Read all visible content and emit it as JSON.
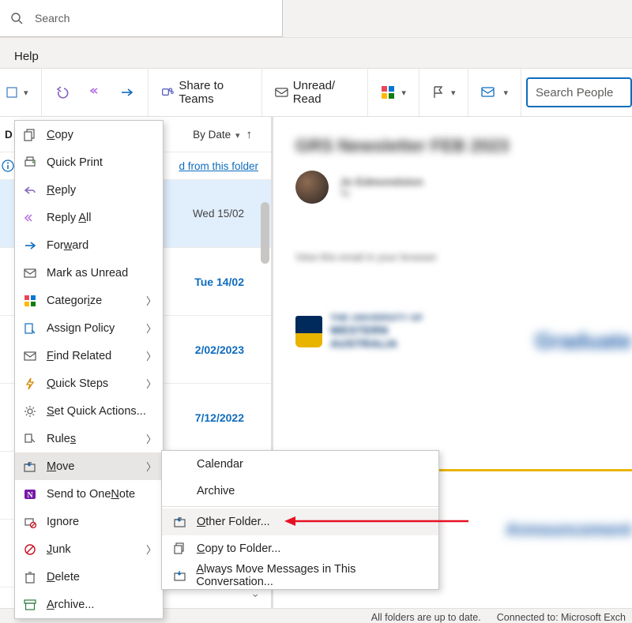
{
  "search": {
    "placeholder": "Search"
  },
  "tabs": {
    "help": "Help"
  },
  "ribbon": {
    "share_teams": "Share to Teams",
    "unread_read": "Unread/ Read",
    "search_people_placeholder": "Search People"
  },
  "list": {
    "sort_label": "By Date",
    "focused_link": "d from this folder",
    "dates": [
      "Wed 15/02",
      "Tue 14/02",
      "2/02/2023",
      "7/12/2022"
    ]
  },
  "reading": {
    "subject": "GRS Newsletter FEB 2023",
    "sender_name": "Jo Edmondston",
    "sender_to": "To",
    "view_hint": "View this email in your browser",
    "uwa_line1": "THE UNIVERSITY OF",
    "uwa_line2": "WESTERN",
    "uwa_line3": "AUSTRALIA",
    "graduate": "Graduate",
    "announce": "Announcement"
  },
  "context_menu": {
    "copy": "Copy",
    "quick_print": "Quick Print",
    "reply": "Reply",
    "reply_all": "Reply All",
    "forward": "Forward",
    "mark_unread": "Mark as Unread",
    "categorize": "Categorize",
    "assign_policy": "Assign Policy",
    "find_related": "Find Related",
    "quick_steps": "Quick Steps",
    "set_quick_actions": "Set Quick Actions...",
    "rules": "Rules",
    "move": "Move",
    "send_onenote": "Send to OneNote",
    "ignore": "Ignore",
    "junk": "Junk",
    "delete": "Delete",
    "archive": "Archive..."
  },
  "move_submenu": {
    "calendar": "Calendar",
    "archive": "Archive",
    "other_folder": "Other Folder...",
    "copy_to_folder": "Copy to Folder...",
    "always_move": "Always Move Messages in This Conversation..."
  },
  "status": {
    "folders": "All folders are up to date.",
    "connected": "Connected to: Microsoft Exch"
  }
}
